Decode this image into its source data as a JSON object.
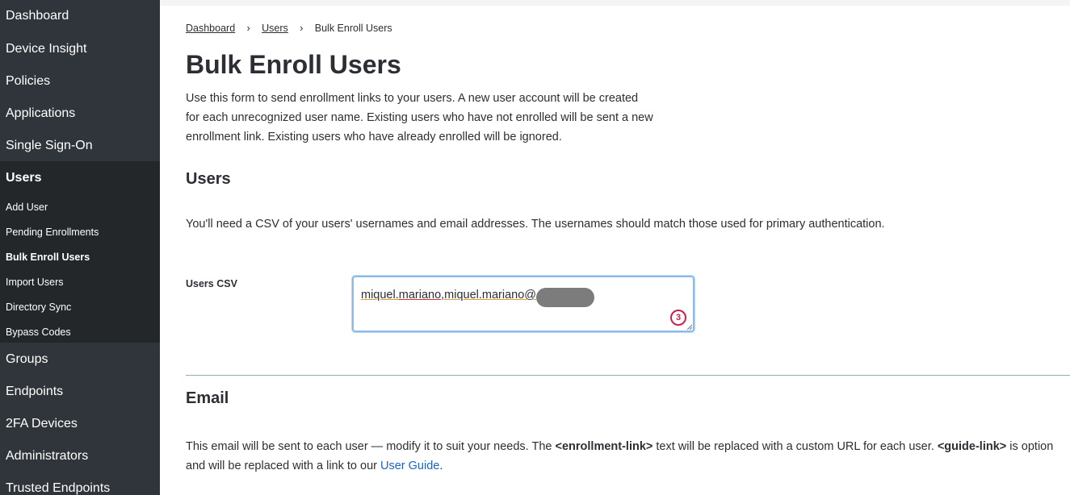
{
  "sidebar": {
    "top_items": [
      "Dashboard",
      "Device Insight",
      "Policies",
      "Applications",
      "Single Sign-On"
    ],
    "users_section": {
      "label": "Users",
      "sub_items": [
        "Add User",
        "Pending Enrollments",
        "Bulk Enroll Users",
        "Import Users",
        "Directory Sync",
        "Bypass Codes"
      ]
    },
    "bottom_items": [
      "Groups",
      "Endpoints",
      "2FA Devices",
      "Administrators",
      "Trusted Endpoints"
    ]
  },
  "breadcrumb": {
    "items": [
      "Dashboard",
      "Users"
    ],
    "current": "Bulk Enroll Users"
  },
  "page": {
    "title": "Bulk Enroll Users",
    "intro": "Use this form to send enrollment links to your users. A new user account will be created for each unrecognized user name. Existing users who have not enrolled will be sent a new enrollment link. Existing users who have already enrolled will be ignored."
  },
  "users_section": {
    "heading": "Users",
    "note": "You'll need a CSV of your users' usernames and email addresses. The usernames should match those used for primary authentication.",
    "csv_label": "Users CSV",
    "csv_value_part1": "miquel.",
    "csv_value_part2": "mariano",
    "csv_value_part3": ",miquel.mariano@",
    "badge_count": "3"
  },
  "email_section": {
    "heading": "Email",
    "note_1": "This email will be sent to each user — modify it to suit your needs. The ",
    "enrollment_token": "<enrollment-link>",
    "note_2": " text will be replaced with a custom URL for each user. ",
    "guide_token": "<guide-link>",
    "note_3": " is option",
    "note_4": "and will be replaced with a link to our ",
    "user_guide_link": "User Guide",
    "note_5": "."
  },
  "colors": {
    "sidebar_bg": "#2f353a",
    "subnav_bg": "#23272a",
    "focus_border": "#8bbbe8",
    "badge": "#cc1f4a",
    "link": "#1a62c4"
  }
}
